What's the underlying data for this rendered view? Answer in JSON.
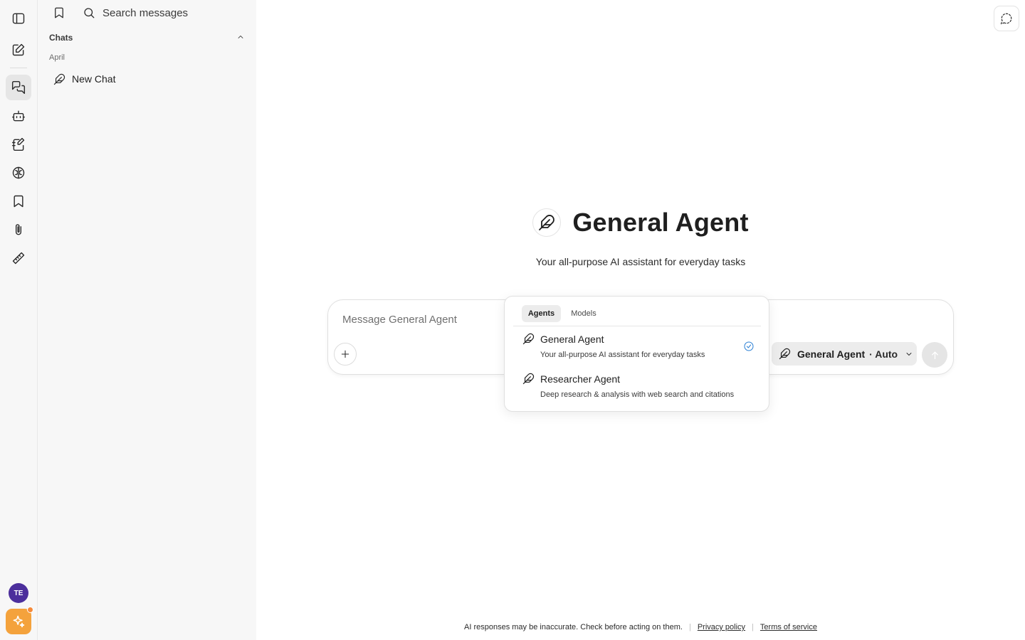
{
  "sidebar": {
    "search": {
      "placeholder": "Search messages"
    },
    "section_title": "Chats",
    "group_label": "April",
    "chats": [
      {
        "label": "New Chat"
      }
    ],
    "user_initials": "TE"
  },
  "main": {
    "hero_title": "General Agent",
    "hero_subtitle": "Your all-purpose AI assistant for everyday tasks",
    "composer": {
      "placeholder": "Message General Agent",
      "agent_name": "General Agent",
      "agent_mode": "· Auto"
    },
    "dropdown": {
      "tabs": [
        {
          "label": "Agents",
          "selected": true
        },
        {
          "label": "Models",
          "selected": false
        }
      ],
      "items": [
        {
          "name": "General Agent",
          "description": "Your all-purpose AI assistant for everyday tasks",
          "selected": true
        },
        {
          "name": "Researcher Agent",
          "description": "Deep research & analysis with web search and citations",
          "selected": false
        }
      ]
    },
    "footer": {
      "disclaimer": "AI responses may be inaccurate. Check before acting on them.",
      "privacy": "Privacy policy",
      "terms": "Terms of service"
    }
  },
  "colors": {
    "accent_check": "#2a7fd4",
    "avatar_bg": "#4c2f9c",
    "spark_bg": "#f4a23c"
  },
  "icons": [
    "sidebar-toggle-icon",
    "new-chat-icon",
    "chats-icon",
    "bot-icon",
    "notes-icon",
    "brain-icon",
    "bookmark-icon",
    "paperclip-icon",
    "ruler-icon",
    "search-icon",
    "chevron-up-icon",
    "feather-icon",
    "plus-icon",
    "arrow-up-icon",
    "check-circle-icon",
    "chevron-down-icon",
    "message-dashed-icon",
    "sparkle-icon"
  ]
}
